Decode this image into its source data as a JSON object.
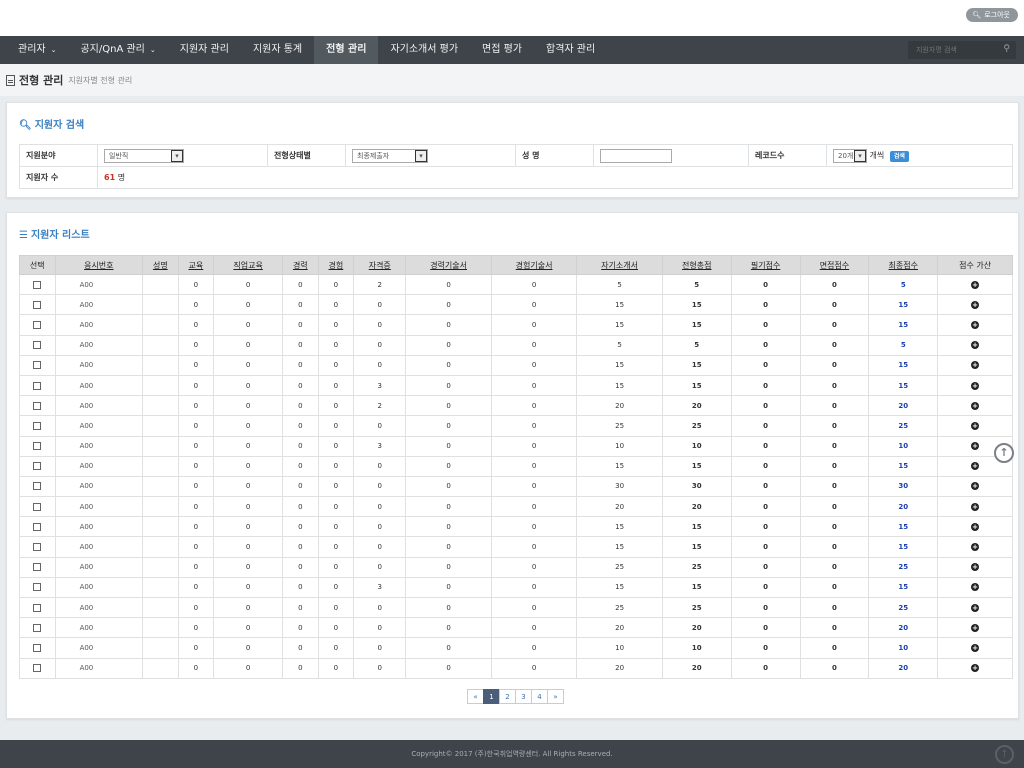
{
  "topbar": {
    "logout_label": "로그아웃"
  },
  "nav": {
    "items": [
      "관리자",
      "공지/QnA 관리",
      "지원자 관리",
      "지원자 통계",
      "전형 관리",
      "자기소개서 평가",
      "면접 평가",
      "합격자 관리"
    ],
    "active_index": 4,
    "search_placeholder": "지원자명 검색"
  },
  "breadcrumb": {
    "title": "전형 관리",
    "subtitle": "지원자별 전형 관리"
  },
  "search_panel": {
    "title": "지원자 검색",
    "field_label": "지원분야",
    "field_value": "일반직",
    "status_label": "전형상태별",
    "status_value": "최종제출자",
    "name_label": "성 명",
    "name_value": "",
    "records_label": "레코드수",
    "records_value": "20개",
    "records_unit": "개씩",
    "search_button": "검색",
    "count_label": "지원자 수",
    "count_value": "61",
    "count_unit": "명"
  },
  "list_panel": {
    "title": "지원자 리스트",
    "columns": [
      "선택",
      "응시번호",
      "성명",
      "교육",
      "직업교육",
      "경력",
      "경험",
      "자격증",
      "경력기술서",
      "경험기술서",
      "자기소개서",
      "전형총점",
      "필기점수",
      "면접점수",
      "최종점수",
      "점수 가산"
    ],
    "rows": [
      {
        "id": "A00",
        "name": "",
        "edu": "0",
        "voc": "0",
        "career": "0",
        "exp": "0",
        "cert": "2",
        "careerDoc": "0",
        "expDoc": "0",
        "intro": "5",
        "total": "5",
        "written": "0",
        "interview": "0",
        "final": "5"
      },
      {
        "id": "A00",
        "name": "",
        "edu": "0",
        "voc": "0",
        "career": "0",
        "exp": "0",
        "cert": "0",
        "careerDoc": "0",
        "expDoc": "0",
        "intro": "15",
        "total": "15",
        "written": "0",
        "interview": "0",
        "final": "15"
      },
      {
        "id": "A00",
        "name": "",
        "edu": "0",
        "voc": "0",
        "career": "0",
        "exp": "0",
        "cert": "0",
        "careerDoc": "0",
        "expDoc": "0",
        "intro": "15",
        "total": "15",
        "written": "0",
        "interview": "0",
        "final": "15"
      },
      {
        "id": "A00",
        "name": "",
        "edu": "0",
        "voc": "0",
        "career": "0",
        "exp": "0",
        "cert": "0",
        "careerDoc": "0",
        "expDoc": "0",
        "intro": "5",
        "total": "5",
        "written": "0",
        "interview": "0",
        "final": "5"
      },
      {
        "id": "A00",
        "name": "",
        "edu": "0",
        "voc": "0",
        "career": "0",
        "exp": "0",
        "cert": "0",
        "careerDoc": "0",
        "expDoc": "0",
        "intro": "15",
        "total": "15",
        "written": "0",
        "interview": "0",
        "final": "15"
      },
      {
        "id": "A00",
        "name": "",
        "edu": "0",
        "voc": "0",
        "career": "0",
        "exp": "0",
        "cert": "3",
        "careerDoc": "0",
        "expDoc": "0",
        "intro": "15",
        "total": "15",
        "written": "0",
        "interview": "0",
        "final": "15"
      },
      {
        "id": "A00",
        "name": "",
        "edu": "0",
        "voc": "0",
        "career": "0",
        "exp": "0",
        "cert": "2",
        "careerDoc": "0",
        "expDoc": "0",
        "intro": "20",
        "total": "20",
        "written": "0",
        "interview": "0",
        "final": "20"
      },
      {
        "id": "A00",
        "name": "",
        "edu": "0",
        "voc": "0",
        "career": "0",
        "exp": "0",
        "cert": "0",
        "careerDoc": "0",
        "expDoc": "0",
        "intro": "25",
        "total": "25",
        "written": "0",
        "interview": "0",
        "final": "25"
      },
      {
        "id": "A00",
        "name": "",
        "edu": "0",
        "voc": "0",
        "career": "0",
        "exp": "0",
        "cert": "3",
        "careerDoc": "0",
        "expDoc": "0",
        "intro": "10",
        "total": "10",
        "written": "0",
        "interview": "0",
        "final": "10"
      },
      {
        "id": "A00",
        "name": "",
        "edu": "0",
        "voc": "0",
        "career": "0",
        "exp": "0",
        "cert": "0",
        "careerDoc": "0",
        "expDoc": "0",
        "intro": "15",
        "total": "15",
        "written": "0",
        "interview": "0",
        "final": "15"
      },
      {
        "id": "A00",
        "name": "",
        "edu": "0",
        "voc": "0",
        "career": "0",
        "exp": "0",
        "cert": "0",
        "careerDoc": "0",
        "expDoc": "0",
        "intro": "30",
        "total": "30",
        "written": "0",
        "interview": "0",
        "final": "30"
      },
      {
        "id": "A00",
        "name": "",
        "edu": "0",
        "voc": "0",
        "career": "0",
        "exp": "0",
        "cert": "0",
        "careerDoc": "0",
        "expDoc": "0",
        "intro": "20",
        "total": "20",
        "written": "0",
        "interview": "0",
        "final": "20"
      },
      {
        "id": "A00",
        "name": "",
        "edu": "0",
        "voc": "0",
        "career": "0",
        "exp": "0",
        "cert": "0",
        "careerDoc": "0",
        "expDoc": "0",
        "intro": "15",
        "total": "15",
        "written": "0",
        "interview": "0",
        "final": "15"
      },
      {
        "id": "A00",
        "name": "",
        "edu": "0",
        "voc": "0",
        "career": "0",
        "exp": "0",
        "cert": "0",
        "careerDoc": "0",
        "expDoc": "0",
        "intro": "15",
        "total": "15",
        "written": "0",
        "interview": "0",
        "final": "15"
      },
      {
        "id": "A00",
        "name": "",
        "edu": "0",
        "voc": "0",
        "career": "0",
        "exp": "0",
        "cert": "0",
        "careerDoc": "0",
        "expDoc": "0",
        "intro": "25",
        "total": "25",
        "written": "0",
        "interview": "0",
        "final": "25"
      },
      {
        "id": "A00",
        "name": "",
        "edu": "0",
        "voc": "0",
        "career": "0",
        "exp": "0",
        "cert": "3",
        "careerDoc": "0",
        "expDoc": "0",
        "intro": "15",
        "total": "15",
        "written": "0",
        "interview": "0",
        "final": "15"
      },
      {
        "id": "A00",
        "name": "",
        "edu": "0",
        "voc": "0",
        "career": "0",
        "exp": "0",
        "cert": "0",
        "careerDoc": "0",
        "expDoc": "0",
        "intro": "25",
        "total": "25",
        "written": "0",
        "interview": "0",
        "final": "25"
      },
      {
        "id": "A00",
        "name": "",
        "edu": "0",
        "voc": "0",
        "career": "0",
        "exp": "0",
        "cert": "0",
        "careerDoc": "0",
        "expDoc": "0",
        "intro": "20",
        "total": "20",
        "written": "0",
        "interview": "0",
        "final": "20"
      },
      {
        "id": "A00",
        "name": "",
        "edu": "0",
        "voc": "0",
        "career": "0",
        "exp": "0",
        "cert": "0",
        "careerDoc": "0",
        "expDoc": "0",
        "intro": "10",
        "total": "10",
        "written": "0",
        "interview": "0",
        "final": "10"
      },
      {
        "id": "A00",
        "name": "",
        "edu": "0",
        "voc": "0",
        "career": "0",
        "exp": "0",
        "cert": "0",
        "careerDoc": "0",
        "expDoc": "0",
        "intro": "20",
        "total": "20",
        "written": "0",
        "interview": "0",
        "final": "20"
      }
    ],
    "pagination": [
      "«",
      "1",
      "2",
      "3",
      "4",
      "»"
    ],
    "current_page": "1"
  },
  "footer": {
    "copyright": "Copyright© 2017 (주)한국취업역량센터. All Rights Reserved."
  },
  "colors": {
    "nav_bg": "#3e444a",
    "accent_blue": "#3a80c0",
    "final_score": "#1c3fb0",
    "count_red": "#d0302a",
    "page_active": "#4b5e79"
  }
}
